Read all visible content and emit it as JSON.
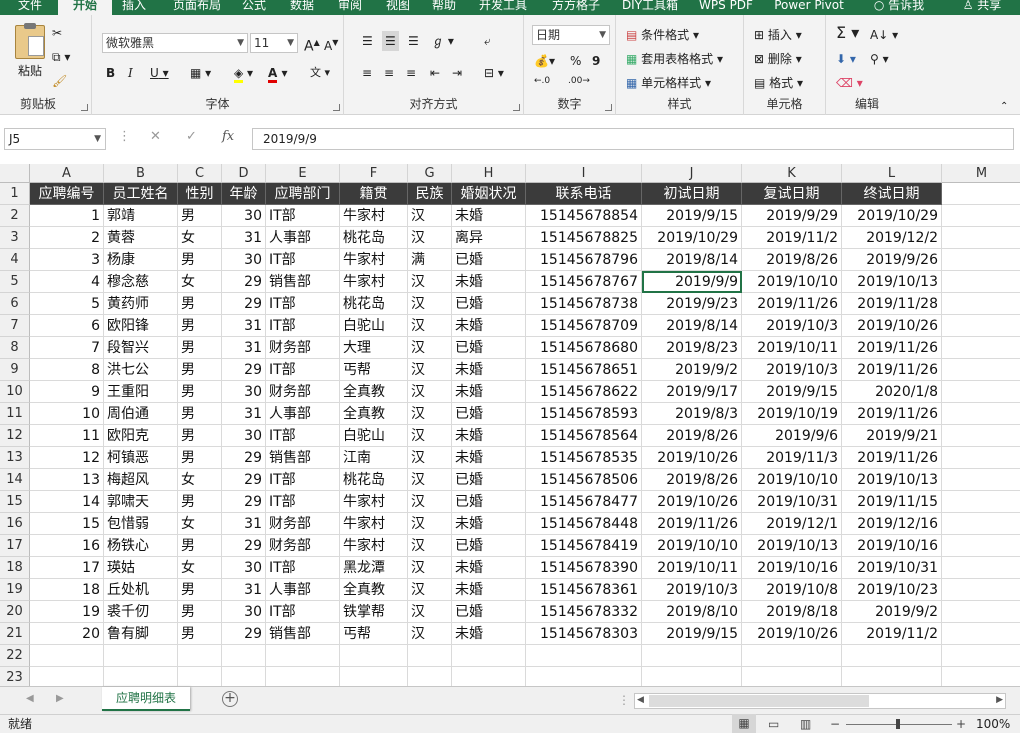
{
  "ribbon_tabs": [
    "文件",
    "开始",
    "插入",
    "页面布局",
    "公式",
    "数据",
    "审阅",
    "视图",
    "帮助",
    "开发工具",
    "方方格子",
    "DIY工具箱",
    "WPS PDF",
    "Power Pivot"
  ],
  "tell_me": "告诉我",
  "share": "共享",
  "clipboard": {
    "paste": "粘贴",
    "label": "剪贴板"
  },
  "font": {
    "name": "微软雅黑",
    "size": "11",
    "grow": "A",
    "shrink": "A",
    "bold": "B",
    "italic": "I",
    "underline": "U",
    "label": "字体"
  },
  "alignment": {
    "label": "对齐方式"
  },
  "number": {
    "format": "日期",
    "percent": "%",
    "comma": "9",
    "label": "数字"
  },
  "styles": {
    "conditional": "条件格式",
    "table": "套用表格格式",
    "cell": "单元格样式",
    "label": "样式"
  },
  "cells": {
    "insert": "插入",
    "delete": "删除",
    "format": "格式",
    "label": "单元格"
  },
  "editing": {
    "label": "编辑"
  },
  "namebox": "J5",
  "formula": "2019/9/9",
  "fx": "fx",
  "columns": [
    "A",
    "B",
    "C",
    "D",
    "E",
    "F",
    "G",
    "H",
    "I",
    "J",
    "K",
    "L",
    "M"
  ],
  "rows": [
    "1",
    "2",
    "3",
    "4",
    "5",
    "6",
    "7",
    "8",
    "9",
    "10",
    "11",
    "12",
    "13",
    "14",
    "15",
    "16",
    "17",
    "18",
    "19",
    "20",
    "21",
    "22",
    "23"
  ],
  "table": {
    "headers": [
      "应聘编号",
      "员工姓名",
      "性别",
      "年龄",
      "应聘部门",
      "籍贯",
      "民族",
      "婚姻状况",
      "联系电话",
      "初试日期",
      "复试日期",
      "终试日期"
    ],
    "rows": [
      [
        "1",
        "郭靖",
        "男",
        "30",
        "IT部",
        "牛家村",
        "汉",
        "未婚",
        "15145678854",
        "2019/9/15",
        "2019/9/29",
        "2019/10/29"
      ],
      [
        "2",
        "黄蓉",
        "女",
        "31",
        "人事部",
        "桃花岛",
        "汉",
        "离异",
        "15145678825",
        "2019/10/29",
        "2019/11/2",
        "2019/12/2"
      ],
      [
        "3",
        "杨康",
        "男",
        "30",
        "IT部",
        "牛家村",
        "满",
        "已婚",
        "15145678796",
        "2019/8/14",
        "2019/8/26",
        "2019/9/26"
      ],
      [
        "4",
        "穆念慈",
        "女",
        "29",
        "销售部",
        "牛家村",
        "汉",
        "未婚",
        "15145678767",
        "2019/9/9",
        "2019/10/10",
        "2019/10/13"
      ],
      [
        "5",
        "黄药师",
        "男",
        "29",
        "IT部",
        "桃花岛",
        "汉",
        "已婚",
        "15145678738",
        "2019/9/23",
        "2019/11/26",
        "2019/11/28"
      ],
      [
        "6",
        "欧阳锋",
        "男",
        "31",
        "IT部",
        "白驼山",
        "汉",
        "未婚",
        "15145678709",
        "2019/8/14",
        "2019/10/3",
        "2019/10/26"
      ],
      [
        "7",
        "段智兴",
        "男",
        "31",
        "财务部",
        "大理",
        "汉",
        "已婚",
        "15145678680",
        "2019/8/23",
        "2019/10/11",
        "2019/11/26"
      ],
      [
        "8",
        "洪七公",
        "男",
        "29",
        "IT部",
        "丐帮",
        "汉",
        "未婚",
        "15145678651",
        "2019/9/2",
        "2019/10/3",
        "2019/11/26"
      ],
      [
        "9",
        "王重阳",
        "男",
        "30",
        "财务部",
        "全真教",
        "汉",
        "未婚",
        "15145678622",
        "2019/9/17",
        "2019/9/15",
        "2020/1/8"
      ],
      [
        "10",
        "周伯通",
        "男",
        "31",
        "人事部",
        "全真教",
        "汉",
        "已婚",
        "15145678593",
        "2019/8/3",
        "2019/10/19",
        "2019/11/26"
      ],
      [
        "11",
        "欧阳克",
        "男",
        "30",
        "IT部",
        "白驼山",
        "汉",
        "未婚",
        "15145678564",
        "2019/8/26",
        "2019/9/6",
        "2019/9/21"
      ],
      [
        "12",
        "柯镇恶",
        "男",
        "29",
        "销售部",
        "江南",
        "汉",
        "未婚",
        "15145678535",
        "2019/10/26",
        "2019/11/3",
        "2019/11/26"
      ],
      [
        "13",
        "梅超风",
        "女",
        "29",
        "IT部",
        "桃花岛",
        "汉",
        "已婚",
        "15145678506",
        "2019/8/26",
        "2019/10/10",
        "2019/10/13"
      ],
      [
        "14",
        "郭啸天",
        "男",
        "29",
        "IT部",
        "牛家村",
        "汉",
        "已婚",
        "15145678477",
        "2019/10/26",
        "2019/10/31",
        "2019/11/15"
      ],
      [
        "15",
        "包惜弱",
        "女",
        "31",
        "财务部",
        "牛家村",
        "汉",
        "未婚",
        "15145678448",
        "2019/11/26",
        "2019/12/1",
        "2019/12/16"
      ],
      [
        "16",
        "杨铁心",
        "男",
        "29",
        "财务部",
        "牛家村",
        "汉",
        "已婚",
        "15145678419",
        "2019/10/10",
        "2019/10/13",
        "2019/10/16"
      ],
      [
        "17",
        "瑛姑",
        "女",
        "30",
        "IT部",
        "黑龙潭",
        "汉",
        "未婚",
        "15145678390",
        "2019/10/11",
        "2019/10/16",
        "2019/10/31"
      ],
      [
        "18",
        "丘处机",
        "男",
        "31",
        "人事部",
        "全真教",
        "汉",
        "未婚",
        "15145678361",
        "2019/10/3",
        "2019/10/8",
        "2019/10/23"
      ],
      [
        "19",
        "裘千仞",
        "男",
        "30",
        "IT部",
        "铁掌帮",
        "汉",
        "已婚",
        "15145678332",
        "2019/8/10",
        "2019/8/18",
        "2019/9/2"
      ],
      [
        "20",
        "鲁有脚",
        "男",
        "29",
        "销售部",
        "丐帮",
        "汉",
        "未婚",
        "15145678303",
        "2019/9/15",
        "2019/10/26",
        "2019/11/2"
      ]
    ]
  },
  "sheet_tab": "应聘明细表",
  "status": {
    "ready": "就绪",
    "zoom": "100%"
  }
}
